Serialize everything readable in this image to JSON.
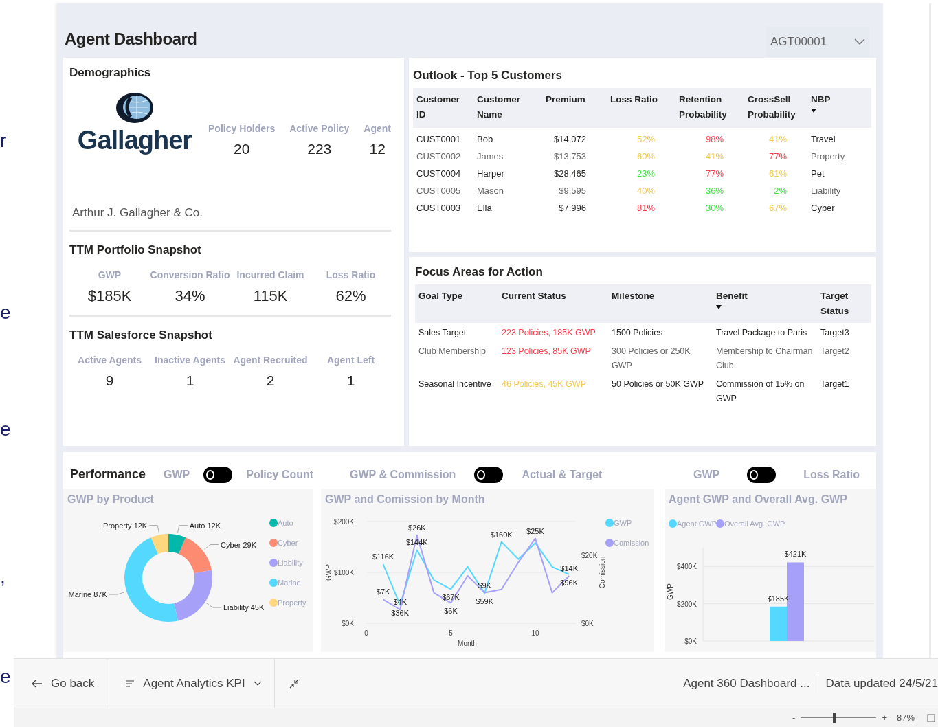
{
  "background_fragments": [
    "r",
    "e",
    "e",
    ",",
    "e"
  ],
  "dashboard": {
    "title": "Agent Dashboard",
    "agent_select": {
      "value": "AGT00001"
    }
  },
  "demographics": {
    "title": "Demographics",
    "logo_text": "Gallagher",
    "company": "Arthur J. Gallagher & Co.",
    "kpis": [
      {
        "label": "Policy Holders",
        "value": "20"
      },
      {
        "label": "Active Policy",
        "value": "223"
      },
      {
        "label": "Agent",
        "value": "12"
      }
    ]
  },
  "portfolio": {
    "title": "TTM Portfolio Snapshot",
    "kpis": [
      {
        "label": "GWP",
        "value": "$185K"
      },
      {
        "label": "Conversion Ratio",
        "value": "34%"
      },
      {
        "label": "Incurred Claim",
        "value": "115K"
      },
      {
        "label": "Loss Ratio",
        "value": "62%"
      }
    ]
  },
  "salesforce": {
    "title": "TTM Salesforce Snapshot",
    "kpis": [
      {
        "label": "Active Agents",
        "value": "9"
      },
      {
        "label": "Inactive Agents",
        "value": "1"
      },
      {
        "label": "Agent Recruited",
        "value": "2"
      },
      {
        "label": "Agent Left",
        "value": "1"
      }
    ]
  },
  "outlook": {
    "title": "Outlook - Top 5 Customers",
    "columns": [
      {
        "label": "Customer ID",
        "kind": "text",
        "sorted": false
      },
      {
        "label": "Customer Name",
        "kind": "text",
        "sorted": false
      },
      {
        "label": "Premium",
        "kind": "number",
        "sorted": false
      },
      {
        "label": "Loss Ratio",
        "kind": "number",
        "sorted": false
      },
      {
        "label": "Retention Probability",
        "kind": "number",
        "sorted": false
      },
      {
        "label": "CrossSell Probability",
        "kind": "number",
        "sorted": false
      },
      {
        "label": "NBP",
        "kind": "text",
        "sorted": true
      }
    ],
    "rows": [
      {
        "cells": [
          {
            "text": "CUST0001"
          },
          {
            "text": "Bob"
          },
          {
            "text": "$14,072"
          },
          {
            "text": "52%",
            "color": "#f2c94c"
          },
          {
            "text": "98%",
            "color": "#fd3b4c"
          },
          {
            "text": "41%",
            "color": "#f2c94c"
          },
          {
            "text": "Travel"
          }
        ]
      },
      {
        "cells": [
          {
            "text": "CUST0002"
          },
          {
            "text": "James"
          },
          {
            "text": "$13,753"
          },
          {
            "text": "60%",
            "color": "#f2c94c"
          },
          {
            "text": "41%",
            "color": "#f2c94c"
          },
          {
            "text": "77%",
            "color": "#fd3b4c"
          },
          {
            "text": "Property"
          }
        ]
      },
      {
        "cells": [
          {
            "text": "CUST0004"
          },
          {
            "text": "Harper"
          },
          {
            "text": "$28,465"
          },
          {
            "text": "23%",
            "color": "#3ee83e"
          },
          {
            "text": "77%",
            "color": "#fd3b4c"
          },
          {
            "text": "61%",
            "color": "#f2c94c"
          },
          {
            "text": "Pet"
          }
        ]
      },
      {
        "cells": [
          {
            "text": "CUST0005"
          },
          {
            "text": "Mason"
          },
          {
            "text": "$9,595"
          },
          {
            "text": "40%",
            "color": "#f2c94c"
          },
          {
            "text": "36%",
            "color": "#3ee83e"
          },
          {
            "text": "2%",
            "color": "#3ee83e"
          },
          {
            "text": "Liability"
          }
        ]
      },
      {
        "cells": [
          {
            "text": "CUST0003"
          },
          {
            "text": "Ella"
          },
          {
            "text": "$7,996"
          },
          {
            "text": "81%",
            "color": "#fd3b4c"
          },
          {
            "text": "30%",
            "color": "#3ee83e"
          },
          {
            "text": "67%",
            "color": "#f2c94c"
          },
          {
            "text": "Cyber"
          }
        ]
      }
    ]
  },
  "focus": {
    "title": "Focus Areas for Action",
    "columns": [
      {
        "label": "Goal Type",
        "sorted": false
      },
      {
        "label": "Current Status",
        "sorted": false
      },
      {
        "label": "Milestone",
        "sorted": false
      },
      {
        "label": "Benefit",
        "sorted": true
      },
      {
        "label": "Target Status",
        "sorted": false
      }
    ],
    "rows": [
      {
        "cells": [
          {
            "text": "Sales Target"
          },
          {
            "text": "223 Policies, 185K GWP",
            "color": "#fd3b4c"
          },
          {
            "text": "1500 Policies"
          },
          {
            "text": "Travel Package to Paris"
          },
          {
            "text": "Target3"
          }
        ]
      },
      {
        "cells": [
          {
            "text": "Club Membership"
          },
          {
            "text": "123 Policies, 85K GWP",
            "color": "#fd3b4c"
          },
          {
            "text": "300 Policies or 250K GWP"
          },
          {
            "text": "Membership to Chairman Club"
          },
          {
            "text": "Target2"
          }
        ]
      },
      {
        "cells": [
          {
            "text": "Seasonal Incentive"
          },
          {
            "text": "46 Policies, 45K GWP",
            "color": "#f2c94c"
          },
          {
            "text": "50 Policies or 50K GWP"
          },
          {
            "text": "Commission of 15% on GWP"
          },
          {
            "text": "Target1"
          }
        ]
      }
    ]
  },
  "performance": {
    "title": "Performance",
    "toggles": [
      {
        "left": "GWP",
        "right": "Policy Count",
        "on": false
      },
      {
        "left": "GWP & Commission",
        "right": "Actual & Target",
        "on": false
      },
      {
        "left": "GWP",
        "right": "Loss Ratio",
        "on": false
      }
    ],
    "charts": [
      {
        "chart_data": {
          "type": "donut",
          "title": "GWP by Product",
          "categories": [
            "Auto",
            "Cyber",
            "Liability",
            "Marine",
            "Property"
          ],
          "values": [
            12,
            29,
            45,
            87,
            12
          ],
          "value_labels": [
            "12K",
            "29K",
            "45K",
            "87K",
            "12K"
          ],
          "colors": [
            "#01b8aa",
            "#fd8b72",
            "#a6a0f8",
            "#55d8fe",
            "#fed77f"
          ],
          "data_labels": true,
          "legend": "right"
        }
      },
      {
        "chart_data": {
          "type": "line",
          "title": "GWP and Comission by Month",
          "xlabel": "Month",
          "ylabel": "GWP",
          "y2label": "Comission",
          "x": [
            1,
            2,
            3,
            4,
            5,
            6,
            7,
            8,
            9,
            10,
            11,
            12
          ],
          "xlim": [
            0,
            12.4
          ],
          "xticks": [
            0,
            5,
            10
          ],
          "ylim": [
            0,
            200
          ],
          "yticks": [
            {
              "value": 0,
              "label": "$0K"
            },
            {
              "value": 100,
              "label": "$100K"
            },
            {
              "value": 200,
              "label": "$200K"
            }
          ],
          "y2lim": [
            0,
            30
          ],
          "y2ticks": [
            {
              "value": 0,
              "label": "$0K"
            },
            {
              "value": 20,
              "label": "$20K"
            }
          ],
          "legend": "right",
          "series": [
            {
              "name": "GWP",
              "color": "#55d8fe",
              "values": [
                116,
                36,
                144,
                85,
                67,
                111,
                59,
                160,
                126,
                158,
                111,
                96
              ]
            },
            {
              "name": "Comission",
              "color": "#a6a0f8",
              "axis": "y2",
              "values": [
                7,
                4,
                26,
                9,
                6,
                14,
                9,
                10,
                18,
                25,
                9,
                14
              ]
            }
          ],
          "value_labels": [
            [
              "$116K",
              "$36K",
              "$144K",
              null,
              "$67K",
              null,
              "$59K",
              "$160K",
              null,
              null,
              null,
              "$96K"
            ],
            [
              "$7K",
              "$4K",
              "$26K",
              null,
              "$6K",
              null,
              "$9K",
              null,
              null,
              "$25K",
              null,
              "$14K"
            ]
          ]
        }
      },
      {
        "chart_data": {
          "type": "bar",
          "title": "Agent GWP and Overall Avg. GWP",
          "ylabel": "GWP",
          "legend": "top",
          "ylim": [
            0,
            500
          ],
          "yticks": [
            {
              "value": 0,
              "label": "$0K"
            },
            {
              "value": 200,
              "label": "$200K"
            },
            {
              "value": 400,
              "label": "$400K"
            }
          ],
          "series": [
            {
              "name": "Agent GWP",
              "color": "#55d8fe",
              "values": [
                185
              ]
            },
            {
              "name": "Overall Avg. GWP",
              "color": "#a6a0f8",
              "values": [
                421
              ]
            }
          ],
          "value_labels": [
            [
              "$185K"
            ],
            [
              "$421K"
            ]
          ]
        }
      }
    ]
  },
  "footer": {
    "back": "Go back",
    "page": "Agent Analytics KPI",
    "report": "Agent 360 Dashboard ...",
    "updated": "Data updated 24/5/21"
  },
  "status_bar": {
    "minus": "-",
    "plus": "+",
    "zoom": {
      "level": 0.44
    },
    "zoom_text": "87%"
  }
}
